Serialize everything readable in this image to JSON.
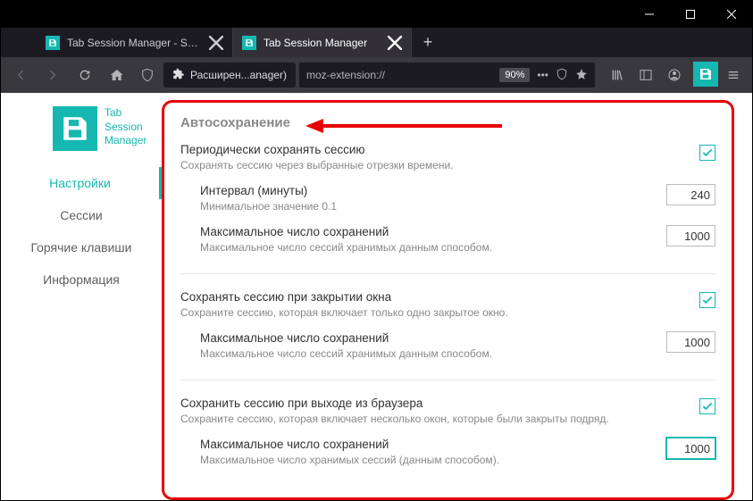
{
  "window": {
    "tabs": [
      {
        "label": "Tab Session Manager - Sess",
        "active": false
      },
      {
        "label": "Tab Session Manager",
        "active": true
      }
    ]
  },
  "addressbar": {
    "ext_label": "Расширен...anager)",
    "url_prefix": "moz-extension://",
    "zoom": "90%"
  },
  "app": {
    "name_line1": "Tab",
    "name_line2": "Session",
    "name_line3": "Manager"
  },
  "sidebar": {
    "items": [
      {
        "label": "Настройки",
        "active": true
      },
      {
        "label": "Сессии",
        "active": false
      },
      {
        "label": "Горячие клавиши",
        "active": false
      },
      {
        "label": "Информация",
        "active": false
      }
    ]
  },
  "section_title": "Автосохранение",
  "settings": {
    "periodic": {
      "label": "Периодически сохранять сессию",
      "desc": "Сохранять сессию через выбранные отрезки времени.",
      "checked": true,
      "interval": {
        "label": "Интервал (минуты)",
        "desc": "Минимальное значение 0.1",
        "value": "240"
      },
      "max": {
        "label": "Максимальное число сохранений",
        "desc": "Максимальное число сессий хранимых данным способом.",
        "value": "1000"
      }
    },
    "on_close": {
      "label": "Сохранять сессию при закрытии окна",
      "desc": "Сохраните сессию, которая включает только одно закрытое окно.",
      "checked": true,
      "max": {
        "label": "Максимальное число сохранений",
        "desc": "Максимальное число сессий хранимых данным способом.",
        "value": "1000"
      }
    },
    "on_exit": {
      "label": "Сохранить сессию при выходе из браузера",
      "desc": "Сохраните сессию, которая включает несколько окон, которые были закрыты подряд.",
      "checked": true,
      "max": {
        "label": "Максимальное число сохранений",
        "desc": "Максимальное число хранимых сессий (данным способом).",
        "value": "1000"
      }
    }
  }
}
